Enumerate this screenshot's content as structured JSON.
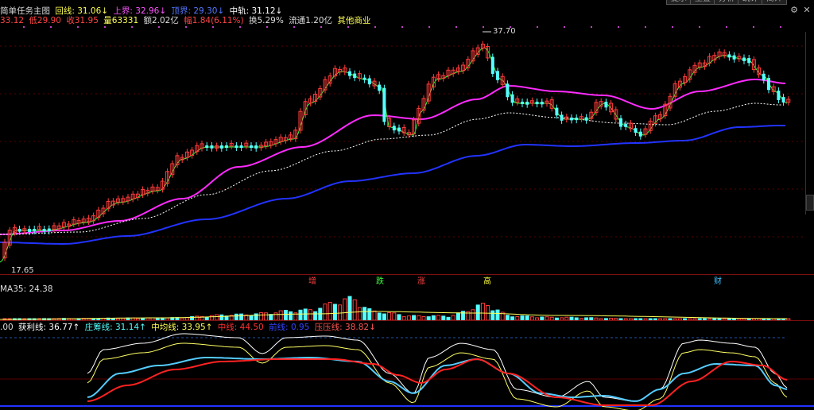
{
  "toolbar": {
    "buttons": [
      "提示",
      "重叠",
      "分析",
      "统计",
      "简介"
    ]
  },
  "header": {
    "line1": {
      "title": "简单任务主图",
      "back_line": "回线: 31.06↓",
      "upper": "上界: 32.96↓",
      "lower": "顶界: 29.30↓",
      "middle": "中轨: 31.12↓"
    },
    "line2": {
      "high": "33.12",
      "low": "低29.90",
      "close": "收31.95",
      "volume": "量63331",
      "amount": "额2.02亿",
      "change": "幅1.84(6.11%)",
      "turnover": "换5.29%",
      "float": "流通1.20亿",
      "industry": "其他商业"
    }
  },
  "price_labels": {
    "peak": "37.70",
    "low": "17.65"
  },
  "volume_panel": {
    "title": "MA35: 24.38"
  },
  "events": [
    {
      "label": "增",
      "color": "#ff4040"
    },
    {
      "label": "跌",
      "color": "#40ff40"
    },
    {
      "label": "涨",
      "color": "#ff4040"
    },
    {
      "label": "高",
      "color": "#ffff40"
    },
    {
      "label": "财",
      "color": "#40c0ff"
    }
  ],
  "indicator": {
    "prefix": ".00",
    "profit": "获利线: 36.77↑",
    "banker": "庄筹线: 31.14↑",
    "average": "中均线: 33.95↑",
    "mid": "中线: 44.50",
    "front": "前线: 0.95",
    "pressure": "压压线: 38.82↓"
  },
  "colors": {
    "up": "#ff3b3b",
    "down": "#55ffff",
    "ma_fast": "#ff2bff",
    "ma_slow": "#2233ff",
    "ma_white": "#ffffff",
    "ma_green": "#3aff3a"
  }
}
